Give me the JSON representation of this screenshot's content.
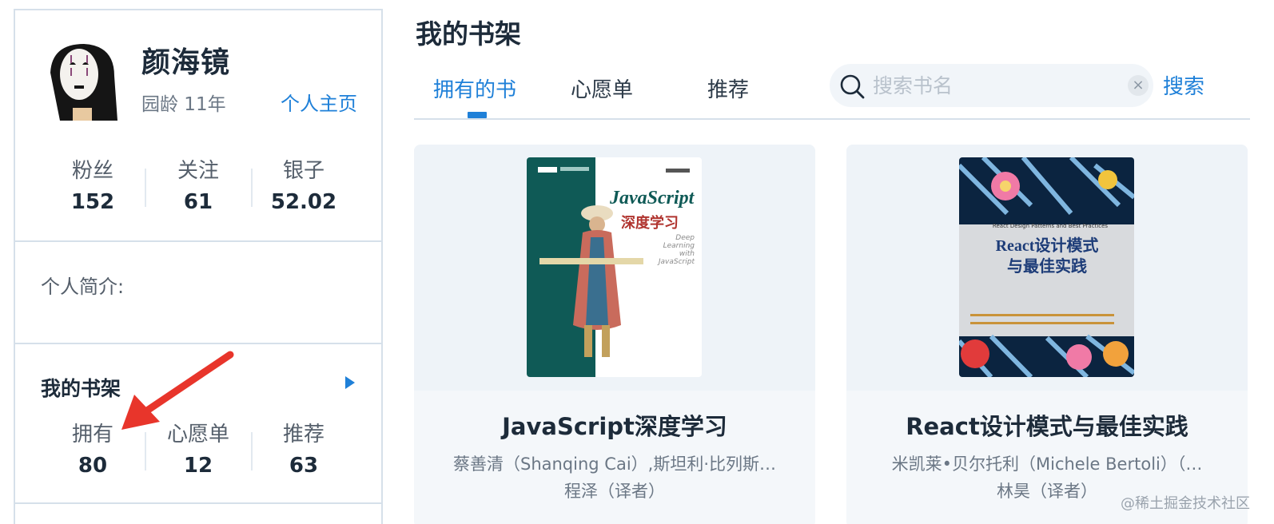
{
  "profile": {
    "name": "颜海镜",
    "age_label": "园龄 11年",
    "home_link": "个人主页",
    "stats": [
      {
        "label": "粉丝",
        "value": "152"
      },
      {
        "label": "关注",
        "value": "61"
      },
      {
        "label": "银子",
        "value": "52.02"
      }
    ]
  },
  "bio": {
    "label": "个人简介:"
  },
  "shelf_panel": {
    "title": "我的书架",
    "stats": [
      {
        "label": "拥有",
        "value": "80"
      },
      {
        "label": "心愿单",
        "value": "12"
      },
      {
        "label": "推荐",
        "value": "63"
      }
    ]
  },
  "main": {
    "title": "我的书架",
    "tabs": [
      {
        "label": "拥有的书",
        "active": true
      },
      {
        "label": "心愿单",
        "active": false
      },
      {
        "label": "推荐",
        "active": false
      }
    ],
    "search": {
      "placeholder": "搜索书名",
      "value": "",
      "button_label": "搜索"
    },
    "books": [
      {
        "title": "JavaScript深度学习",
        "author": "蔡善清（Shanqing Cai）,斯坦利·比列斯…",
        "translator": "程泽（译者）",
        "cover": {
          "title_en": "JavaScript",
          "title_cn": "深度学习",
          "subtitle": "Deep Learning with JavaScript"
        }
      },
      {
        "title": "React设计模式与最佳实践",
        "author": "米凯莱•贝尔托利（Michele Bertoli）（…",
        "translator": "林昊（译者）",
        "cover": {
          "subtitle": "React Design Patterns and Best Practices",
          "title_line1": "React设计模式",
          "title_line2": "与最佳实践"
        }
      }
    ]
  },
  "watermark": "@稀土掘金技术社区",
  "colors": {
    "accent": "#1f80d8",
    "annotation": "#e8352b",
    "text": "#1d2b3a"
  }
}
